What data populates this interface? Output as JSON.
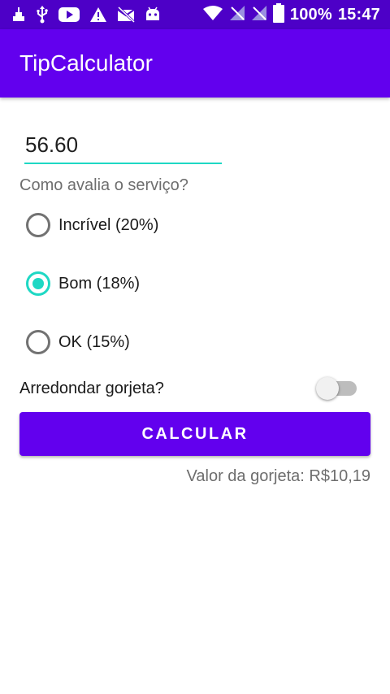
{
  "status_bar": {
    "battery_text": "100%",
    "time": "15:47",
    "left_icons": [
      "notification-icon",
      "usb-icon",
      "youtube-icon",
      "warning-icon",
      "mail-off-icon",
      "android-icon"
    ],
    "right_icons": [
      "wifi-icon",
      "no-signal-icon",
      "no-signal-icon",
      "battery-icon"
    ]
  },
  "app_bar": {
    "title": "TipCalculator"
  },
  "form": {
    "amount_value": "56.60",
    "question": "Como avalia o serviço?",
    "options": [
      {
        "label": "Incrível (20%)",
        "checked": false
      },
      {
        "label": "Bom (18%)",
        "checked": true
      },
      {
        "label": "OK (15%)",
        "checked": false
      }
    ],
    "round_label": "Arredondar gorjeta?",
    "round_on": false,
    "calculate_label": "CALCULAR",
    "result": "Valor da gorjeta: R$10,19"
  },
  "colors": {
    "primary": "#6200ee",
    "primary_dark": "#4d00c7",
    "accent": "#1ed8c4"
  }
}
